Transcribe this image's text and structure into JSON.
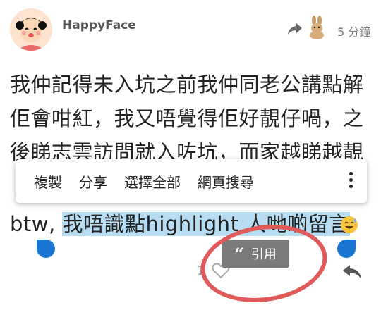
{
  "post": {
    "username": "HappyFace",
    "timestamp": "5 分鐘",
    "line1": "我仲記得未入坑之前我仲同老公講點解",
    "line2": "佢會咁紅，我又唔覺得佢好靚仔喎，之",
    "line3": "後睇志雲訪問就入咗坑，而家越睇越靚",
    "line4_plain": "btw, ",
    "line4_selected": "我唔識點highlight 人哋啲留言",
    "like_count": "1"
  },
  "context_menu": {
    "items": [
      "複製",
      "分享",
      "選擇全部",
      "網頁搜尋"
    ]
  },
  "quote_button": {
    "icon": "“",
    "label": "引用"
  },
  "colors": {
    "selection": "#b8ddf3",
    "cursor": "#1976d2",
    "annotation": "#e05a5a"
  },
  "icons": [
    "share-icon",
    "rabbit-icon",
    "more-vert-icon",
    "heart-icon",
    "reply-icon",
    "sweat-smile-emoji"
  ]
}
